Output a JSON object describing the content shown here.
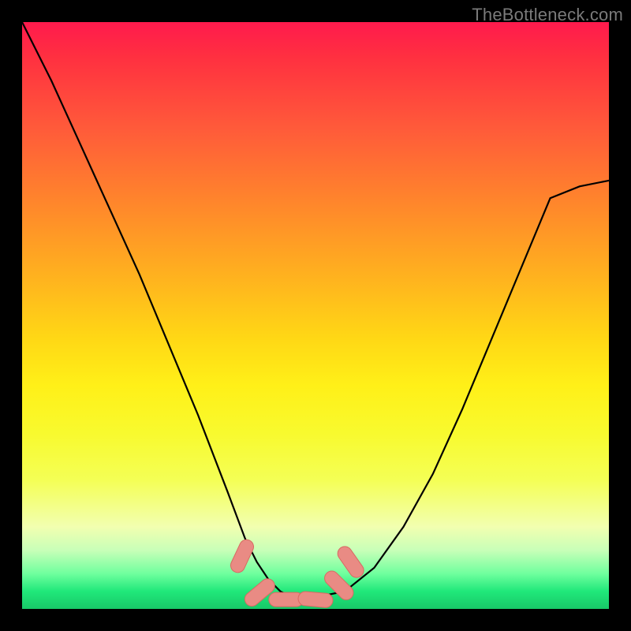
{
  "watermark": "TheBottleneck.com",
  "chart_data": {
    "type": "line",
    "title": "",
    "xlabel": "",
    "ylabel": "",
    "ylim": [
      0,
      100
    ],
    "xlim": [
      0,
      100
    ],
    "series": [
      {
        "name": "curve",
        "x": [
          0,
          5,
          10,
          15,
          20,
          25,
          30,
          35,
          38,
          40,
          42,
          44,
          46,
          48,
          50,
          55,
          60,
          65,
          70,
          75,
          80,
          85,
          90,
          95,
          100
        ],
        "values": [
          100,
          90,
          79,
          68,
          57,
          45,
          33,
          20,
          12,
          8,
          5,
          3,
          2,
          2,
          2,
          3,
          7,
          14,
          23,
          34,
          46,
          58,
          70,
          72,
          73
        ]
      }
    ],
    "markers": [
      {
        "x": 37.5,
        "y": 9,
        "angle": -65
      },
      {
        "x": 40.5,
        "y": 2.8,
        "angle": -40
      },
      {
        "x": 45,
        "y": 1.6,
        "angle": 0
      },
      {
        "x": 50,
        "y": 1.6,
        "angle": 5
      },
      {
        "x": 54,
        "y": 4,
        "angle": 45
      },
      {
        "x": 56,
        "y": 8,
        "angle": 55
      }
    ],
    "gradient_bands": [
      {
        "pos": 0,
        "color": "#ff1a4d"
      },
      {
        "pos": 50,
        "color": "#ffd815"
      },
      {
        "pos": 80,
        "color": "#f4ff55"
      },
      {
        "pos": 95,
        "color": "#20e87a"
      },
      {
        "pos": 100,
        "color": "#18c868"
      }
    ]
  }
}
